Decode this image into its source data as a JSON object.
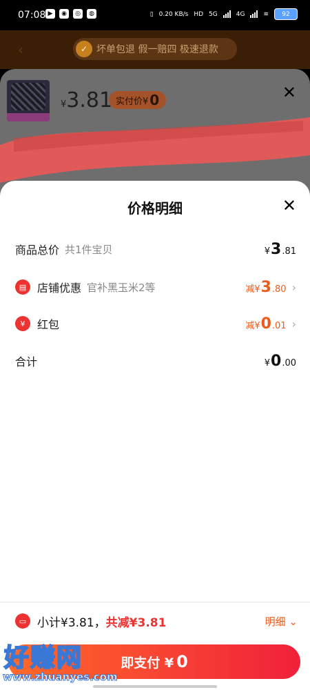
{
  "status": {
    "time": "07:08",
    "net_speed": "0.20 KB/s",
    "net1": "5G",
    "net2": "4G",
    "battery": "92"
  },
  "promo": {
    "text": "坏单包退 假一赔四 极速退款"
  },
  "product": {
    "currency": "¥",
    "price": "3.81",
    "actual_label": "实付价¥",
    "actual_value": "0"
  },
  "sheet": {
    "title": "价格明细",
    "rows": [
      {
        "label": "商品总价",
        "sub": "共1件宝贝",
        "prefix": "¥",
        "int": "3",
        "dec": ".81"
      },
      {
        "label": "店铺优惠",
        "sub": "官补黑玉米2等",
        "prefix": "减¥",
        "int": "3",
        "dec": ".80"
      },
      {
        "label": "红包",
        "sub": "",
        "prefix": "减¥",
        "int": "0",
        "dec": ".01"
      },
      {
        "label": "合计",
        "sub": "",
        "prefix": "¥",
        "int": "0",
        "dec": ".00"
      }
    ]
  },
  "footer": {
    "subtotal": "小计¥3.81，",
    "reduced": "共减¥3.81",
    "detail_link": "明细",
    "pay_label": "即支付 ¥",
    "pay_value": "0"
  },
  "watermark": {
    "text": "好赚网",
    "url": "www.zhuanyes.com"
  },
  "colors": {
    "accent": "#ee5a1a",
    "red": "#ee3232"
  }
}
